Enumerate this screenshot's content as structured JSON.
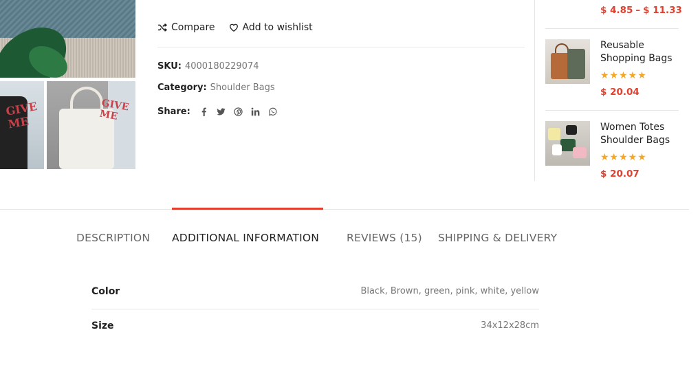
{
  "product": {
    "actions": {
      "compare_label": "Compare",
      "wishlist_label": "Add to wishlist"
    },
    "meta": {
      "sku_label": "SKU:",
      "sku_value": "4000180229074",
      "category_label": "Category:",
      "category_value": "Shoulder Bags",
      "share_label": "Share:",
      "share_icons": [
        "facebook-icon",
        "twitter-icon",
        "pinterest-icon",
        "linkedin-icon",
        "whatsapp-icon"
      ]
    }
  },
  "sidebar": {
    "top_price_from": "$ 4.85",
    "top_price_sep": "–",
    "top_price_to": "$ 11.33",
    "items": [
      {
        "title": "Reusable Shopping Bags",
        "rating": 5,
        "stars": "★★★★★",
        "price": "$ 20.04"
      },
      {
        "title": "Women Totes Shoulder Bags",
        "rating": 5,
        "stars": "★★★★★",
        "price": "$ 20.07"
      }
    ]
  },
  "tabs": [
    {
      "label": "DESCRIPTION",
      "active": false
    },
    {
      "label": "ADDITIONAL INFORMATION",
      "active": true
    },
    {
      "label": "REVIEWS (15)",
      "active": false
    },
    {
      "label": "SHIPPING & DELIVERY",
      "active": false
    }
  ],
  "attributes": [
    {
      "label": "Color",
      "value": "Black, Brown, green, pink, white, yellow"
    },
    {
      "label": "Size",
      "value": "34x12x28cm"
    }
  ],
  "colors": {
    "accent": "#e1402f",
    "star": "#f5a623",
    "divider": "#e5e5e5"
  }
}
